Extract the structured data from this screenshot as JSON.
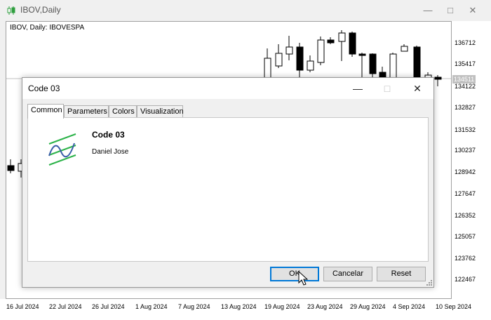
{
  "window": {
    "title": "IBOV,Daily",
    "icon": "candlestick-chart-icon",
    "minimize_icon": "minimize-icon",
    "maximize_icon": "maximize-icon",
    "close_icon": "close-icon"
  },
  "chart": {
    "label": "IBOV, Daily:  IBOVESPA",
    "current_price": "134511",
    "price_axis": [
      "136712",
      "135417",
      "134122",
      "132827",
      "131532",
      "130237",
      "128942",
      "127647",
      "126352",
      "125057",
      "123762",
      "122467"
    ],
    "time_axis": [
      "16 Jul 2024",
      "22 Jul 2024",
      "26 Jul 2024",
      "1 Aug 2024",
      "7 Aug 2024",
      "13 Aug 2024",
      "19 Aug 2024",
      "23 Aug 2024",
      "29 Aug 2024",
      "4 Sep 2024",
      "10 Sep 2024"
    ]
  },
  "dialog": {
    "title": "Code 03",
    "tabs": [
      "Common",
      "Parameters",
      "Colors",
      "Visualization"
    ],
    "active_tab": "Common",
    "indicator_name": "Code 03",
    "author": "Daniel Jose",
    "icon": "indicator-wave-icon",
    "buttons": {
      "ok": "OK",
      "cancel": "Cancelar",
      "reset": "Reset"
    },
    "colors": {
      "accent": "#0078d7",
      "indicator_green": "#2db34a",
      "indicator_blue": "#3a5ea8"
    }
  }
}
